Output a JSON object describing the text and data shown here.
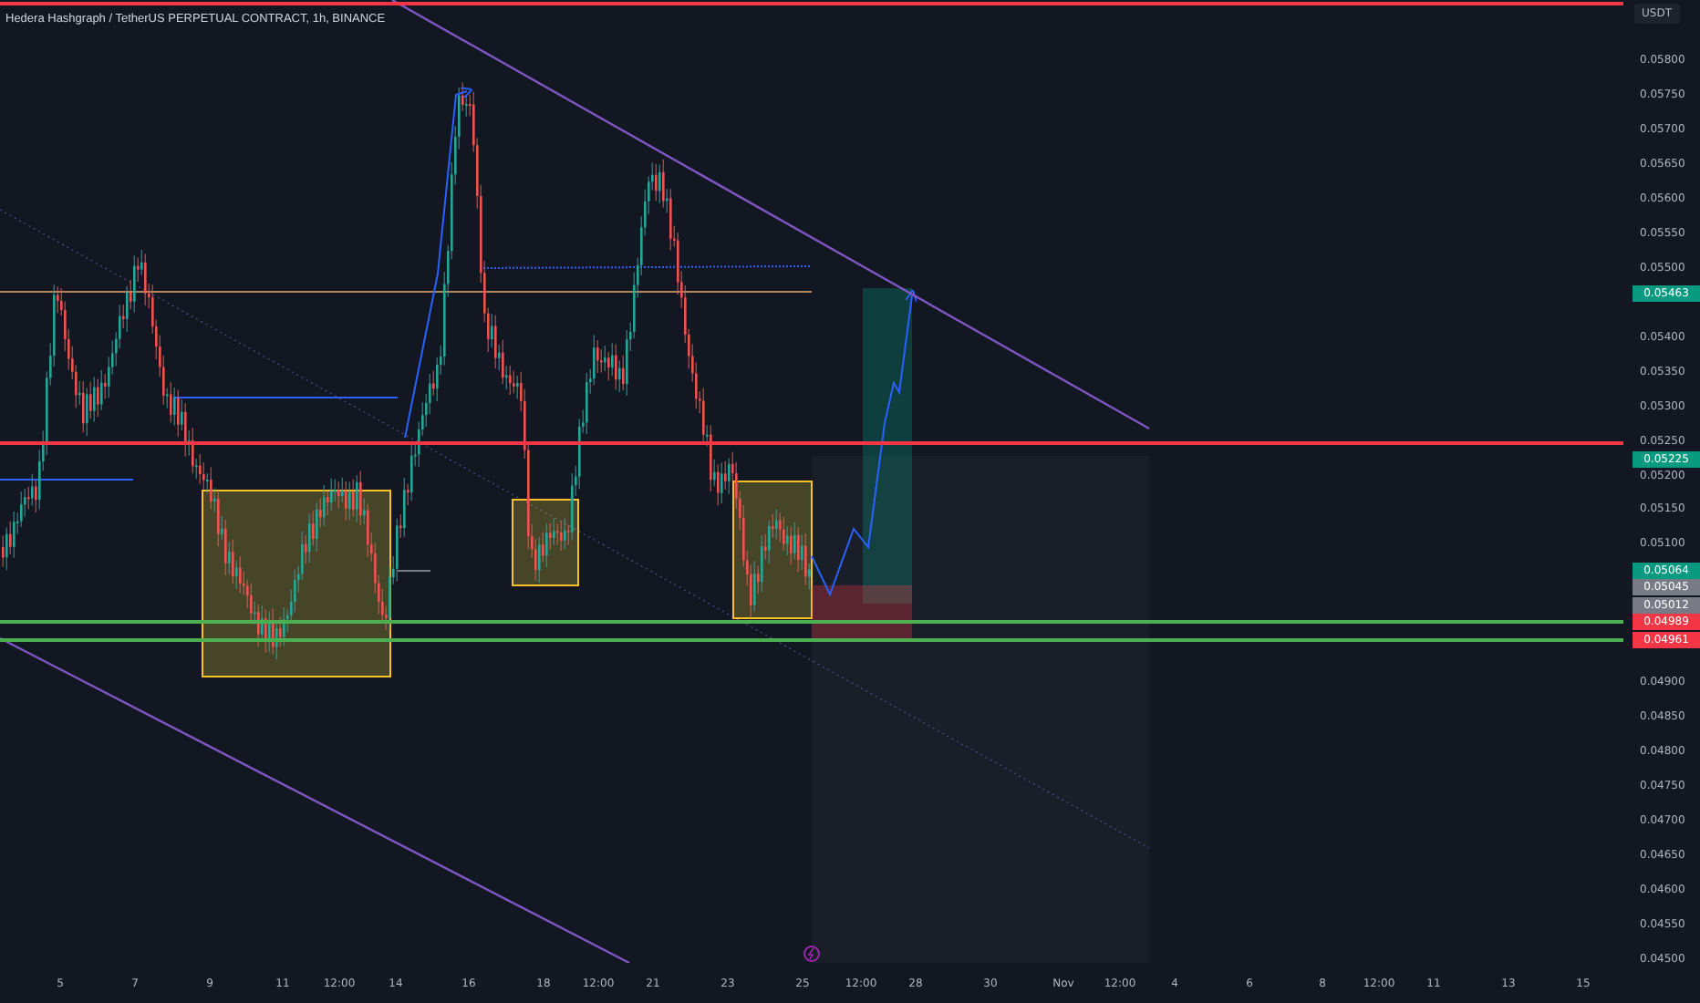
{
  "chart": {
    "title": "Hedera Hashgraph / TetherUS PERPETUAL CONTRACT, 1h, BINANCE"
  },
  "price_axis": {
    "currency": "USDT",
    "labels": [
      "0.05800",
      "0.05750",
      "0.05700",
      "0.05650",
      "0.05600",
      "0.05550",
      "0.05500",
      "0.05400",
      "0.05350",
      "0.05300",
      "0.05250",
      "0.05200",
      "0.05150",
      "0.05100",
      "0.04900",
      "0.04850",
      "0.04800",
      "0.04750",
      "0.04700",
      "0.04650",
      "0.04600",
      "0.04550",
      "0.04500"
    ],
    "badges": [
      {
        "text": "0.05463",
        "color": "#089981"
      },
      {
        "text": "0.05225",
        "color": "#089981"
      },
      {
        "text": "0.05064",
        "color": "#089981"
      },
      {
        "text": "0.05045",
        "color": "#787b86"
      },
      {
        "text": "0.05012",
        "color": "#787b86"
      },
      {
        "text": "0.04989",
        "color": "#f23645"
      },
      {
        "text": "0.04961",
        "color": "#f23645"
      }
    ]
  },
  "time_axis": {
    "labels": [
      "5",
      "7",
      "9",
      "11",
      "12:00",
      "14",
      "16",
      "18",
      "12:00",
      "21",
      "23",
      "25",
      "12:00",
      "28",
      "30",
      "Nov",
      "12:00",
      "4",
      "6",
      "8",
      "12:00",
      "11",
      "13",
      "15"
    ]
  }
}
